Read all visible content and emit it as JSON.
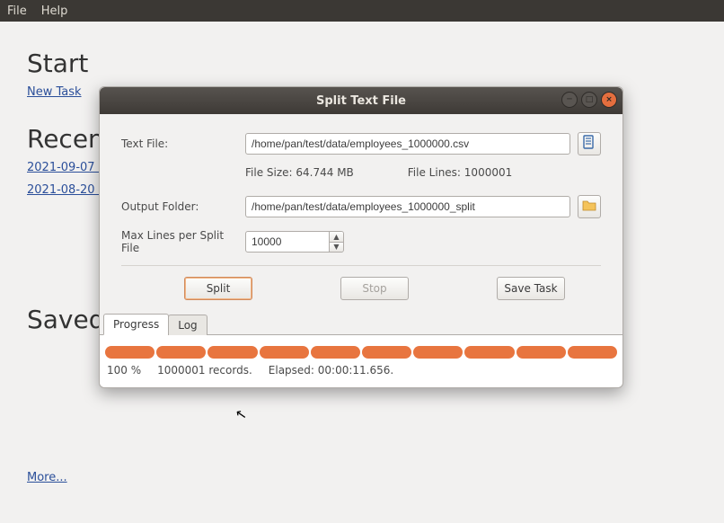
{
  "menubar": {
    "file": "File",
    "help": "Help"
  },
  "main": {
    "start_heading": "Start",
    "new_task": "New Task",
    "recent_heading": "Recent",
    "recent_items": [
      "2021-09-07 1",
      "2021-08-20 1"
    ],
    "saved_heading": "Saved T",
    "more": "More..."
  },
  "dialog": {
    "title": "Split Text File",
    "text_file_label": "Text File:",
    "text_file_value": "/home/pan/test/data/employees_1000000.csv",
    "file_size_label": "File Size: 64.744 MB",
    "file_lines_label": "File Lines: 1000001",
    "output_folder_label": "Output Folder:",
    "output_folder_value": "/home/pan/test/data/employees_1000000_split",
    "max_lines_label": "Max Lines per Split File",
    "max_lines_value": "10000",
    "split_btn": "Split",
    "stop_btn": "Stop",
    "save_task_btn": "Save Task",
    "tabs": {
      "progress": "Progress",
      "log": "Log"
    },
    "progress": {
      "percent": "100 %",
      "records": "1000001 records.",
      "elapsed": "Elapsed: 00:00:11.656."
    }
  }
}
